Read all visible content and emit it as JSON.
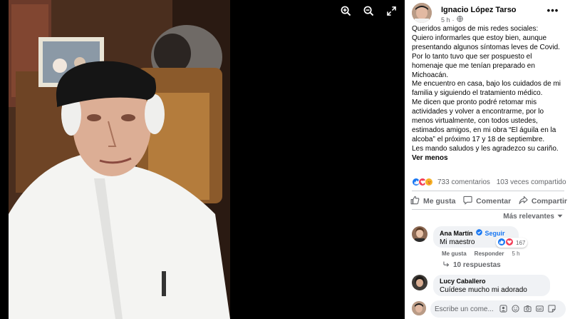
{
  "media": {
    "controls": [
      {
        "name": "zoom-in-icon"
      },
      {
        "name": "zoom-out-icon"
      },
      {
        "name": "fullscreen-icon"
      }
    ]
  },
  "post": {
    "author": "Ignacio López Tarso",
    "time": "5 h",
    "privacy_icon": "globe-icon",
    "more_label": "•••",
    "text_lines": [
      "Queridos amigos de mis redes sociales:",
      "Quiero informarles que estoy bien, aunque",
      "presentando algunos síntomas leves de Covid.",
      "Por lo tanto tuvo que ser pospuesto el",
      "homenaje que me tenían preparado en",
      "Michoacán.",
      "Me encuentro en casa, bajo los cuidados de mi",
      "familia y siguiendo el tratamiento médico.",
      "Me dicen que pronto podré retomar mis",
      "actividades y volver a encontrarme, por lo",
      "menos virtualmente, con todos ustedes,",
      "estimados amigos, en mi obra “El águila en la",
      "alcoba” el próximo 17 y 18 de septiembre.",
      "Les mando saludos y les agradezco su cariño."
    ],
    "see_less": "Ver menos",
    "comments_count": "733 comentarios",
    "shares_count": "103 veces compartido"
  },
  "actions": {
    "like": "Me gusta",
    "comment": "Comentar",
    "share": "Compartir"
  },
  "sort": {
    "label": "Más relevantes"
  },
  "comments": [
    {
      "name": "Ana Martín",
      "follow": "Seguir",
      "text": "Mi maestro",
      "reaction_count": "167",
      "like": "Me gusta",
      "reply": "Responder",
      "time": "5 h",
      "replies": "10 respuestas"
    },
    {
      "name": "Lucy Caballero",
      "text": "Cuídese mucho mi adorado"
    }
  ],
  "composer": {
    "placeholder": "Escribe un come..."
  },
  "colors": {
    "accent": "#1877f2",
    "like": "#1877f2",
    "love": "#f33e58",
    "care": "#f7b125",
    "secondary_text": "#65676b"
  }
}
